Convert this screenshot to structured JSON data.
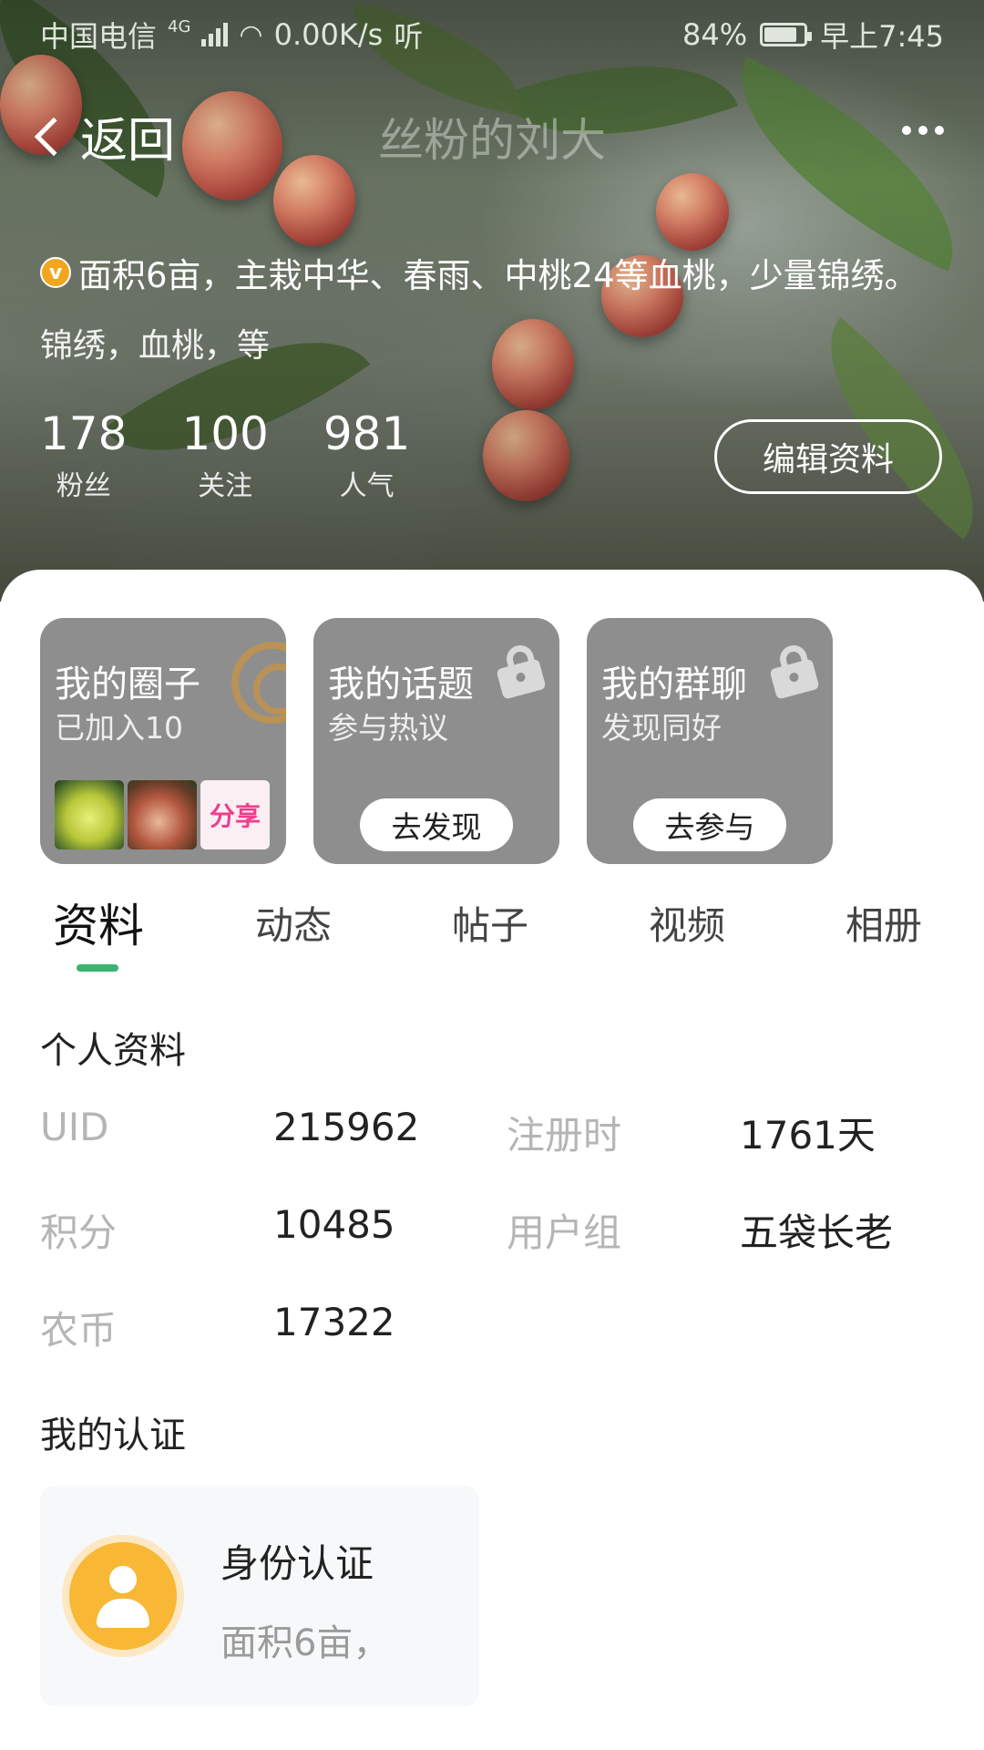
{
  "status_bar": {
    "carrier": "中国电信",
    "network": "4G",
    "speed": "0.00K/s",
    "extra": "听",
    "battery": "84%",
    "battery_level": 0.84,
    "time": "早上7:45"
  },
  "nav": {
    "back_label": "返回",
    "title": "丝粉的刘大"
  },
  "profile": {
    "bio": "面积6亩，主栽中华、春雨、中桃24等血桃，少量锦绣。",
    "tags": "锦绣，血桃，等",
    "stats": [
      {
        "value": "178",
        "label": "粉丝"
      },
      {
        "value": "100",
        "label": "关注"
      },
      {
        "value": "981",
        "label": "人气"
      }
    ],
    "edit_label": "编辑资料"
  },
  "cards": [
    {
      "title": "我的圈子",
      "subtitle": "已加入10",
      "thumb_text": "分享"
    },
    {
      "title": "我的话题",
      "subtitle": "参与热议",
      "button": "去发现"
    },
    {
      "title": "我的群聊",
      "subtitle": "发现同好",
      "button": "去参与"
    }
  ],
  "tabs": [
    "资料",
    "动态",
    "帖子",
    "视频",
    "相册"
  ],
  "active_tab": "资料",
  "personal_info": {
    "title": "个人资料",
    "rows": [
      {
        "label1": "UID",
        "value1": "215962",
        "label2": "注册时",
        "value2": "1761天"
      },
      {
        "label1": "积分",
        "value1": "10485",
        "label2": "用户组",
        "value2": "五袋长老"
      },
      {
        "label1": "农币",
        "value1": "17322"
      }
    ]
  },
  "certification": {
    "title": "我的认证",
    "card_title": "身份认证",
    "card_desc": "面积6亩，"
  },
  "colors": {
    "accent_green": "#3cb371",
    "badge_orange": "#f0a71e",
    "card_gray": "#8e8e8e"
  }
}
